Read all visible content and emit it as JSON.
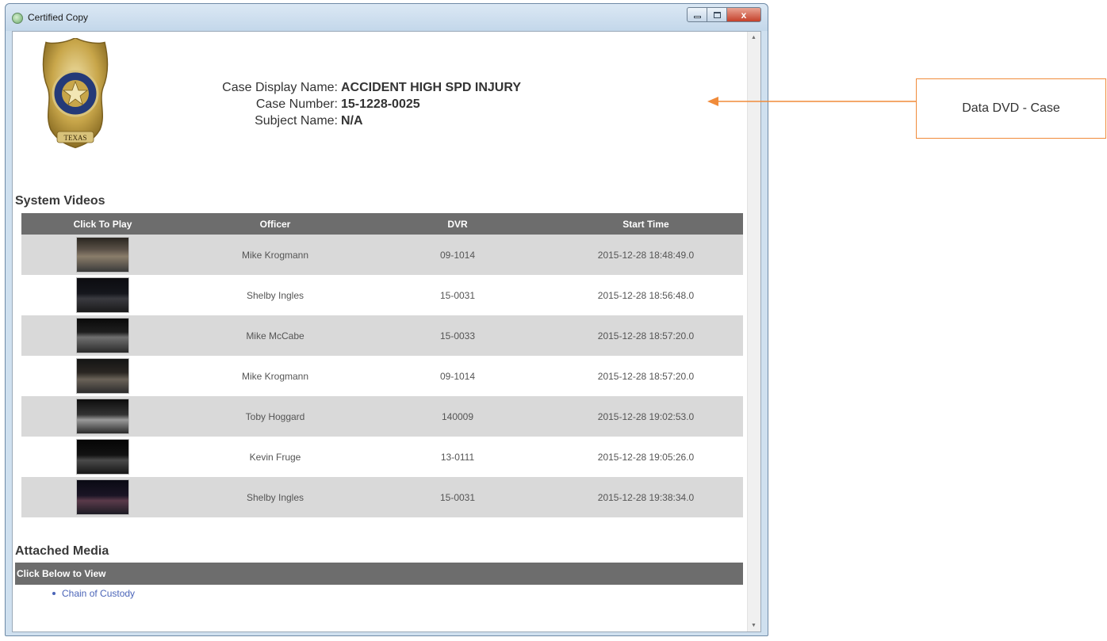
{
  "window": {
    "title": "Certified Copy",
    "close_label": "x"
  },
  "case": {
    "display_name_label": "Case Display Name:",
    "display_name": "ACCIDENT HIGH SPD INJURY",
    "number_label": "Case Number:",
    "number": "15-1228-0025",
    "subject_label": "Subject Name:",
    "subject": "N/A"
  },
  "badge": {
    "text": "TEXAS",
    "icon": "police-badge-icon",
    "colors": {
      "gold": "#c8a64a",
      "navy": "#243a78"
    }
  },
  "videos": {
    "section_title": "System Videos",
    "columns": [
      "Click To Play",
      "Officer",
      "DVR",
      "Start Time"
    ],
    "rows": [
      {
        "officer": "Mike Krogmann",
        "dvr": "09-1014",
        "start": "2015-12-28 18:48:49.0"
      },
      {
        "officer": "Shelby Ingles",
        "dvr": "15-0031",
        "start": "2015-12-28 18:56:48.0"
      },
      {
        "officer": "Mike McCabe",
        "dvr": "15-0033",
        "start": "2015-12-28 18:57:20.0"
      },
      {
        "officer": "Mike Krogmann",
        "dvr": "09-1014",
        "start": "2015-12-28 18:57:20.0"
      },
      {
        "officer": "Toby Hoggard",
        "dvr": "140009",
        "start": "2015-12-28 19:02:53.0"
      },
      {
        "officer": "Kevin Fruge",
        "dvr": "13-0111",
        "start": "2015-12-28 19:05:26.0"
      },
      {
        "officer": "Shelby Ingles",
        "dvr": "15-0031",
        "start": "2015-12-28 19:38:34.0"
      }
    ]
  },
  "media": {
    "section_title": "Attached Media",
    "header": "Click Below to View",
    "items": [
      "Chain of Custody"
    ]
  },
  "annotation": {
    "label": "Data DVD - Case",
    "color": "#f08b3a"
  },
  "colors": {
    "table_header": "#6d6d6d",
    "row_shade": "#d9d9d9",
    "link": "#4a64b8"
  }
}
